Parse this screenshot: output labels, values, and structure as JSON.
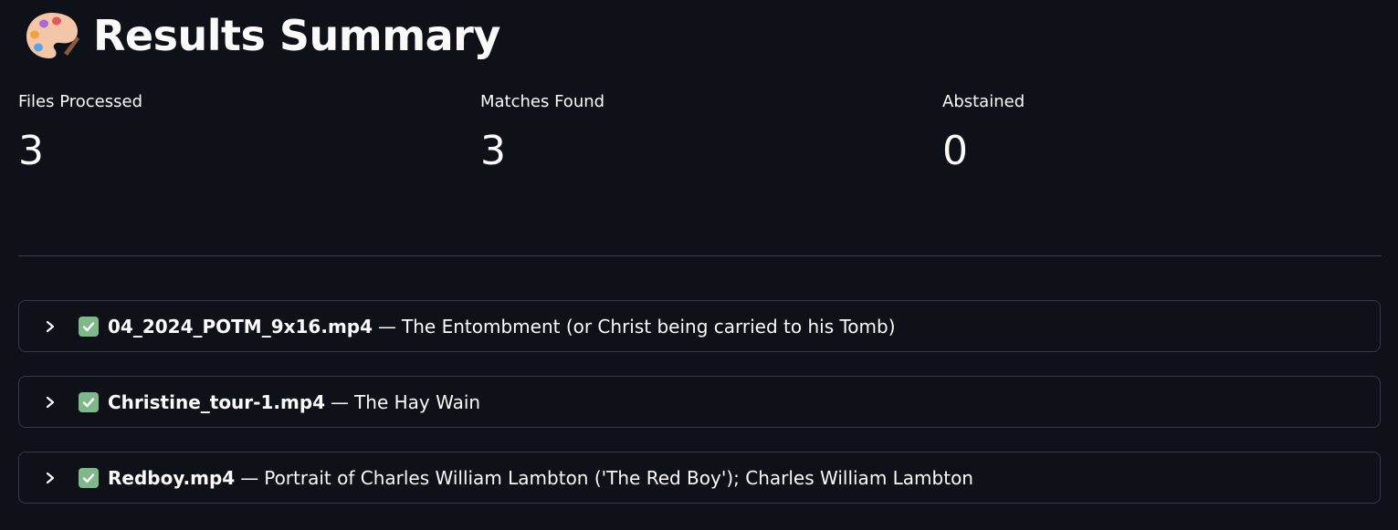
{
  "header": {
    "title": "Results Summary",
    "icon": "artist-palette-icon"
  },
  "metrics": [
    {
      "label": "Files Processed",
      "value": "3"
    },
    {
      "label": "Matches Found",
      "value": "3"
    },
    {
      "label": "Abstained",
      "value": "0"
    }
  ],
  "results": [
    {
      "status": "matched",
      "file": "04_2024_POTM_9x16.mp4",
      "separator": "—",
      "description": "The Entombment (or Christ being carried to his Tomb)"
    },
    {
      "status": "matched",
      "file": "Christine_tour-1.mp4",
      "separator": "—",
      "description": "The Hay Wain"
    },
    {
      "status": "matched",
      "file": "Redboy.mp4",
      "separator": "—",
      "description": "Portrait of Charles William Lambton ('The Red Boy'); Charles William Lambton"
    }
  ],
  "colors": {
    "background": "#0e1117",
    "text": "#fafafa",
    "border": "#363946",
    "check": "#7fb88a"
  }
}
